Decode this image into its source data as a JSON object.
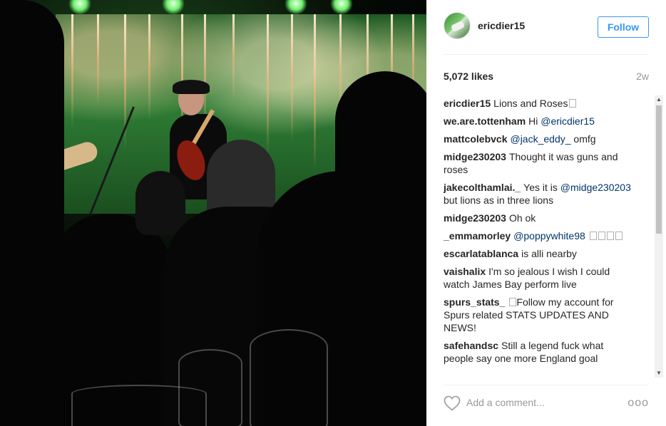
{
  "post": {
    "username": "ericdier15",
    "follow_label": "Follow",
    "likes": "5,072 likes",
    "time_ago": "2w"
  },
  "comments": [
    {
      "user": "ericdier15",
      "text": "Lions and Roses",
      "extra": "box"
    },
    {
      "user": "we.are.tottenham",
      "text": "Hi ",
      "mention": "@ericdier15"
    },
    {
      "user": "mattcolebvck",
      "mention": "@jack_eddy_",
      "text_after": " omfg"
    },
    {
      "user": "midge230203",
      "text": "Thought it was guns and roses"
    },
    {
      "user": "jakecolthamlai._",
      "text": "Yes it is ",
      "mention": "@midge230203",
      "text_after": " but lions as in three lions"
    },
    {
      "user": "midge230203",
      "text": "Oh ok"
    },
    {
      "user": "_emmamorley",
      "mention": "@poppywhite98",
      "extra": "boxes"
    },
    {
      "user": "escarlatablanca",
      "text": "is alli nearby"
    },
    {
      "user": "vaishalix",
      "text": "I'm so jealous I wish I could watch James Bay perform live"
    },
    {
      "user": "spurs_stats_",
      "text": "Follow my account for Spurs related STATS UPDATES AND NEWS!",
      "extra": "prebox"
    },
    {
      "user": "safehandsc",
      "text": "Still a legend fuck what people say one more England goal"
    }
  ],
  "footer": {
    "placeholder": "Add a comment...",
    "more": "ooo"
  },
  "icons": {
    "heart": "heart-icon",
    "more": "more-options-icon"
  },
  "colors": {
    "accent": "#3897f0",
    "mention": "#003569"
  }
}
